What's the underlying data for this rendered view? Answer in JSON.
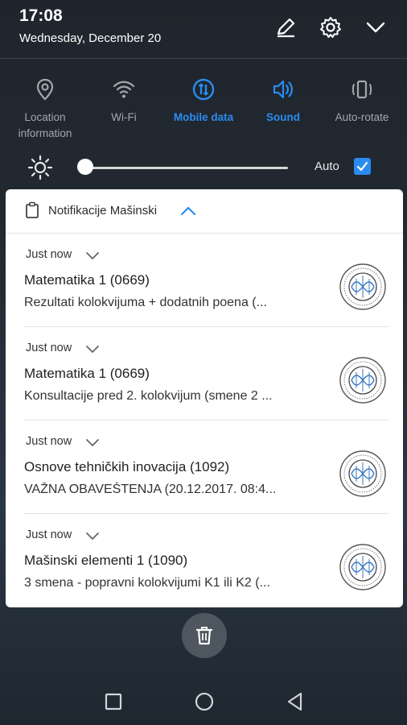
{
  "status": {
    "time": "17:08",
    "date": "Wednesday, December 20"
  },
  "header_icons": [
    "edit-icon",
    "gear-icon",
    "chevron-down-icon"
  ],
  "toggles": [
    {
      "label": "Location information",
      "active": false,
      "icon": "location-icon"
    },
    {
      "label": "Wi-Fi",
      "active": false,
      "icon": "wifi-icon"
    },
    {
      "label": "Mobile data",
      "active": true,
      "icon": "mobile-data-icon"
    },
    {
      "label": "Sound",
      "active": true,
      "icon": "sound-icon"
    },
    {
      "label": "Auto-rotate",
      "active": false,
      "icon": "auto-rotate-icon"
    }
  ],
  "brightness": {
    "level": 0.0,
    "auto_label": "Auto",
    "auto_checked": true
  },
  "notification_group": {
    "app_name": "Notifikacije Mašinski",
    "items": [
      {
        "when": "Just now",
        "title": "Matematika 1 (0669)",
        "body": "Rezultati kolokvijuma + dodatnih poena (..."
      },
      {
        "when": "Just now",
        "title": "Matematika 1 (0669)",
        "body": "Konsultacije pred 2. kolokvijum (smene 2 ..."
      },
      {
        "when": "Just now",
        "title": "Osnove tehničkih inovacija (1092)",
        "body": "VAŽNA OBAVEŠTENJA (20.12.2017. 08:4..."
      },
      {
        "when": "Just now",
        "title": "Mašinski elementi 1 (1090)",
        "body": "3 smena - popravni kolokvijumi K1 ili K2 (..."
      }
    ]
  },
  "colors": {
    "accent": "#2a8cf0",
    "inactive": "#a3a7ab",
    "background": "#222931"
  }
}
